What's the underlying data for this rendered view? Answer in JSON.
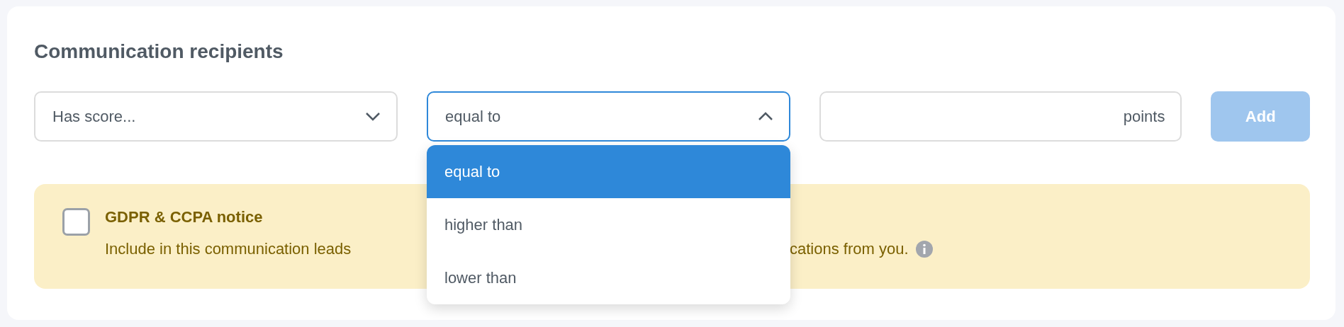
{
  "title": "Communication recipients",
  "filters": [
    {
      "kind": "select",
      "value": "Has score...",
      "expanded": false
    },
    {
      "kind": "select",
      "value": "equal to",
      "expanded": true,
      "options": [
        {
          "label": "equal to",
          "selected": true
        },
        {
          "label": "higher than",
          "selected": false
        },
        {
          "label": "lower than",
          "selected": false
        }
      ]
    },
    {
      "kind": "input",
      "suffix": "points"
    }
  ],
  "add_button": {
    "label": "Add",
    "disabled": true
  },
  "notice": {
    "title": "GDPR & CCPA notice",
    "checked": false,
    "text_before": "Include in this communication leads",
    "text_after": "cations from you."
  }
}
